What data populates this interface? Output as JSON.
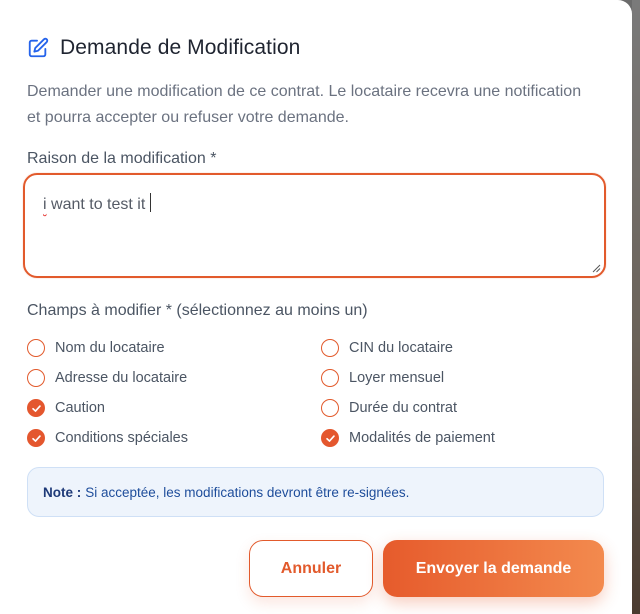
{
  "dialog": {
    "title": "Demande de Modification",
    "description": "Demander une modification de ce contrat. Le locataire recevra une notification et pourra accepter ou refuser votre demande.",
    "reason": {
      "label": "Raison de la modification *",
      "value_first_word": "i",
      "value_rest": " want to test it"
    },
    "fields": {
      "label": "Champs à modifier * (sélectionnez au moins un)",
      "options": [
        {
          "label": "Nom du locataire",
          "checked": false
        },
        {
          "label": "CIN du locataire",
          "checked": false
        },
        {
          "label": "Adresse du locataire",
          "checked": false
        },
        {
          "label": "Loyer mensuel",
          "checked": false
        },
        {
          "label": "Caution",
          "checked": true
        },
        {
          "label": "Durée du contrat",
          "checked": false
        },
        {
          "label": "Conditions spéciales",
          "checked": true
        },
        {
          "label": "Modalités de paiement",
          "checked": true
        }
      ]
    },
    "note": {
      "prefix": "Note :",
      "text": "Si acceptée, les modifications devront être re-signées."
    },
    "buttons": {
      "cancel": "Annuler",
      "submit": "Envoyer la demande"
    }
  },
  "colors": {
    "accent": "#e4572e",
    "note_bg": "#eef4fc",
    "note_text": "#1e4d9b",
    "title_icon": "#2563eb"
  }
}
